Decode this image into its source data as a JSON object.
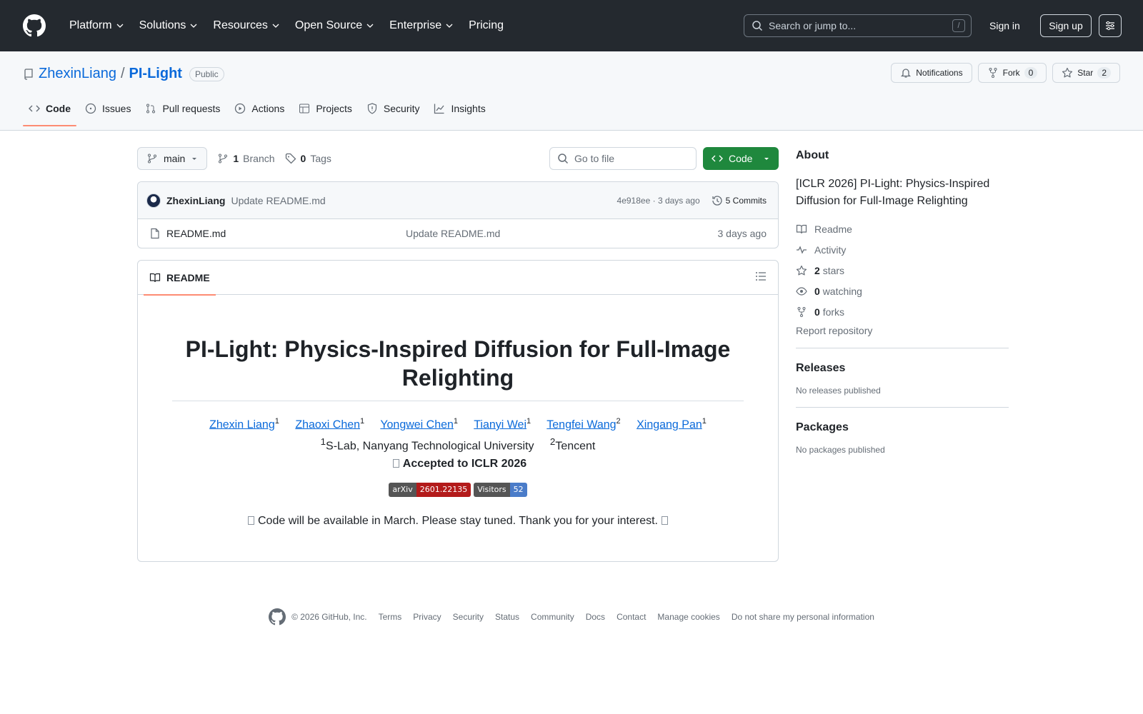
{
  "header": {
    "nav": [
      "Platform",
      "Solutions",
      "Resources",
      "Open Source",
      "Enterprise",
      "Pricing"
    ],
    "search_placeholder": "Search or jump to...",
    "slash_key": "/",
    "sign_in": "Sign in",
    "sign_up": "Sign up"
  },
  "repo": {
    "owner": "ZhexinLiang",
    "separator": "/",
    "name": "PI-Light",
    "visibility": "Public",
    "notifications": "Notifications",
    "fork_label": "Fork",
    "fork_count": "0",
    "star_label": "Star",
    "star_count": "2",
    "tabs": [
      "Code",
      "Issues",
      "Pull requests",
      "Actions",
      "Projects",
      "Security",
      "Insights"
    ]
  },
  "toolbar": {
    "branch": "main",
    "branch_count": "1",
    "branch_label": "Branch",
    "tag_count": "0",
    "tag_label": "Tags",
    "goto_placeholder": "Go to file",
    "code_button": "Code"
  },
  "commit": {
    "author": "ZhexinLiang",
    "message": "Update README.md",
    "hash": "4e918ee",
    "dot": "·",
    "time": "3 days ago",
    "commits": "5 Commits"
  },
  "files": [
    {
      "name": "README.md",
      "message": "Update README.md",
      "date": "3 days ago"
    }
  ],
  "readme": {
    "tab_label": "README",
    "title": "PI-Light: Physics-Inspired Diffusion for Full-Image Relighting",
    "authors": [
      {
        "name": "Zhexin Liang",
        "sup": "1"
      },
      {
        "name": "Zhaoxi Chen",
        "sup": "1"
      },
      {
        "name": "Yongwei Chen",
        "sup": "1"
      },
      {
        "name": "Tianyi Wei",
        "sup": "1"
      },
      {
        "name": "Tengfei Wang",
        "sup": "2"
      },
      {
        "name": "Xingang Pan",
        "sup": "1"
      }
    ],
    "affiliations": [
      {
        "sup": "1",
        "text": "S-Lab, Nanyang Technological University"
      },
      {
        "sup": "2",
        "text": "Tencent"
      }
    ],
    "accepted": "Accepted to ICLR 2026",
    "badges": [
      {
        "left": "arXiv",
        "right": "2601.22135",
        "color": "#b31b1b"
      },
      {
        "left": "Visitors",
        "right": "52",
        "color": "#4a7cc9"
      }
    ],
    "notice": "Code will be available in March. Please stay tuned. Thank you for your interest."
  },
  "sidebar": {
    "about_title": "About",
    "description": "[ICLR 2026] PI-Light: Physics-Inspired Diffusion for Full-Image Relighting",
    "readme": "Readme",
    "activity": "Activity",
    "stars_count": "2",
    "stars_label": "stars",
    "watching_count": "0",
    "watching_label": "watching",
    "forks_count": "0",
    "forks_label": "forks",
    "report": "Report repository",
    "releases_title": "Releases",
    "releases_empty": "No releases published",
    "packages_title": "Packages",
    "packages_empty": "No packages published"
  },
  "footer": {
    "copyright": "© 2026 GitHub, Inc.",
    "links": [
      "Terms",
      "Privacy",
      "Security",
      "Status",
      "Community",
      "Docs",
      "Contact",
      "Manage cookies",
      "Do not share my personal information"
    ]
  },
  "colors": {
    "header_bg": "#24292f",
    "link": "#0969da",
    "primary_button": "#1f883d",
    "active_tab_underline": "#fd8c73"
  }
}
